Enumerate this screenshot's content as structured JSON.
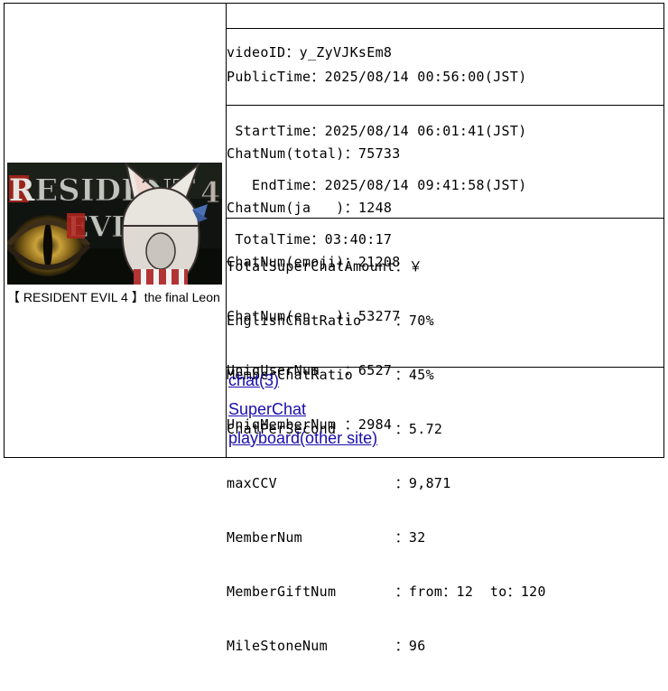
{
  "video": {
    "title": "【 RESIDENT EVIL 4 】the final Leon",
    "thumbnail_text": {
      "word1": "RESIDENT",
      "word2": "EVIL",
      "number": "4"
    }
  },
  "info": {
    "video_id": "videoID：y_ZyVJKsEm8",
    "public_time": "PublicTime：2025/08/14 00:56:00(JST)",
    "start_time": " StartTime：2025/08/14 06:01:41(JST)",
    "end_time": "   EndTime：2025/08/14 09:41:58(JST)",
    "total_time": " TotalTime：03:40:17"
  },
  "chat_stats": {
    "total": "ChatNum(total)：75733",
    "ja": "ChatNum(ja   )：1248",
    "emoji": "ChatNum(emoji)：21208",
    "en": "ChatNum(en   )：53277",
    "uniq_user": "UniqUserNum   ：6527",
    "uniq_member": "UniqMemberNum ：2984"
  },
  "super_stats": {
    "total_superchat": "TotalSuperChatAmount：￥",
    "english_ratio": "EnglishChatRatio    ：70%",
    "member_ratio": "MemberChatRatio     ：45%",
    "chat_per_second": "ChatPerSecond       ：5.72",
    "max_ccv": "maxCCV              ：9,871",
    "member_num": "MemberNum           ：32",
    "member_gift": "MemberGiftNum       ：from：12  to：120",
    "milestone": "MileStoneNum        ：96"
  },
  "links": {
    "chat": "chat(3)",
    "superchat": "SuperChat",
    "playboard": "playboard(other site)"
  },
  "colors": {
    "link": "#1a0dab",
    "thumb_red": "#b3251c"
  }
}
